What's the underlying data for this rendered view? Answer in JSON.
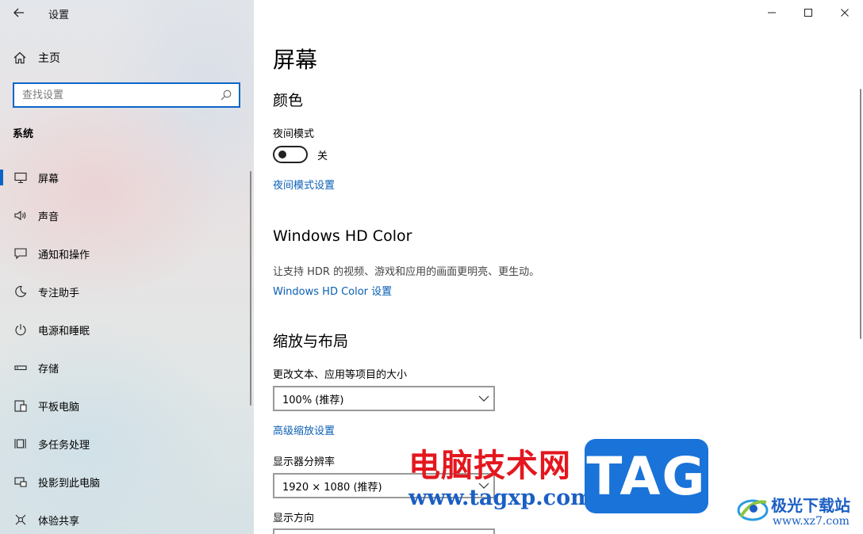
{
  "window": {
    "title": "设置"
  },
  "sidebar": {
    "home_label": "主页",
    "search_placeholder": "查找设置",
    "section_title": "系统",
    "items": [
      {
        "label": "屏幕",
        "icon": "monitor-icon",
        "selected": true
      },
      {
        "label": "声音",
        "icon": "speaker-icon"
      },
      {
        "label": "通知和操作",
        "icon": "notification-icon"
      },
      {
        "label": "专注助手",
        "icon": "moon-icon"
      },
      {
        "label": "电源和睡眠",
        "icon": "power-icon"
      },
      {
        "label": "存储",
        "icon": "storage-icon"
      },
      {
        "label": "平板电脑",
        "icon": "tablet-icon"
      },
      {
        "label": "多任务处理",
        "icon": "multitask-icon"
      },
      {
        "label": "投影到此电脑",
        "icon": "project-icon"
      },
      {
        "label": "体验共享",
        "icon": "share-icon"
      }
    ]
  },
  "main": {
    "page_title": "屏幕",
    "color_section": {
      "heading": "颜色",
      "night_mode_label": "夜间模式",
      "night_mode_state": "关",
      "night_mode_on": false,
      "night_mode_settings_link": "夜间模式设置"
    },
    "hd_color_section": {
      "heading": "Windows HD Color",
      "description": "让支持 HDR 的视频、游戏和应用的画面更明亮、更生动。",
      "settings_link": "Windows HD Color 设置"
    },
    "scale_section": {
      "heading": "缩放与布局",
      "scale_label": "更改文本、应用等项目的大小",
      "scale_value": "100% (推荐)",
      "advanced_scaling_link": "高级缩放设置",
      "resolution_label": "显示器分辨率",
      "resolution_value": "1920 × 1080 (推荐)",
      "orientation_label": "显示方向"
    }
  },
  "watermark": {
    "site_name": "电脑技术网",
    "site_url": "www.tagxp.com",
    "tag_label": "TAG",
    "logo_name": "极光下载站",
    "logo_url": "www.xz7.com"
  },
  "colors": {
    "accent": "#0a64c8",
    "link": "#0a5fb6",
    "watermark_red": "#e4171e",
    "watermark_blue": "#1a73d9"
  }
}
